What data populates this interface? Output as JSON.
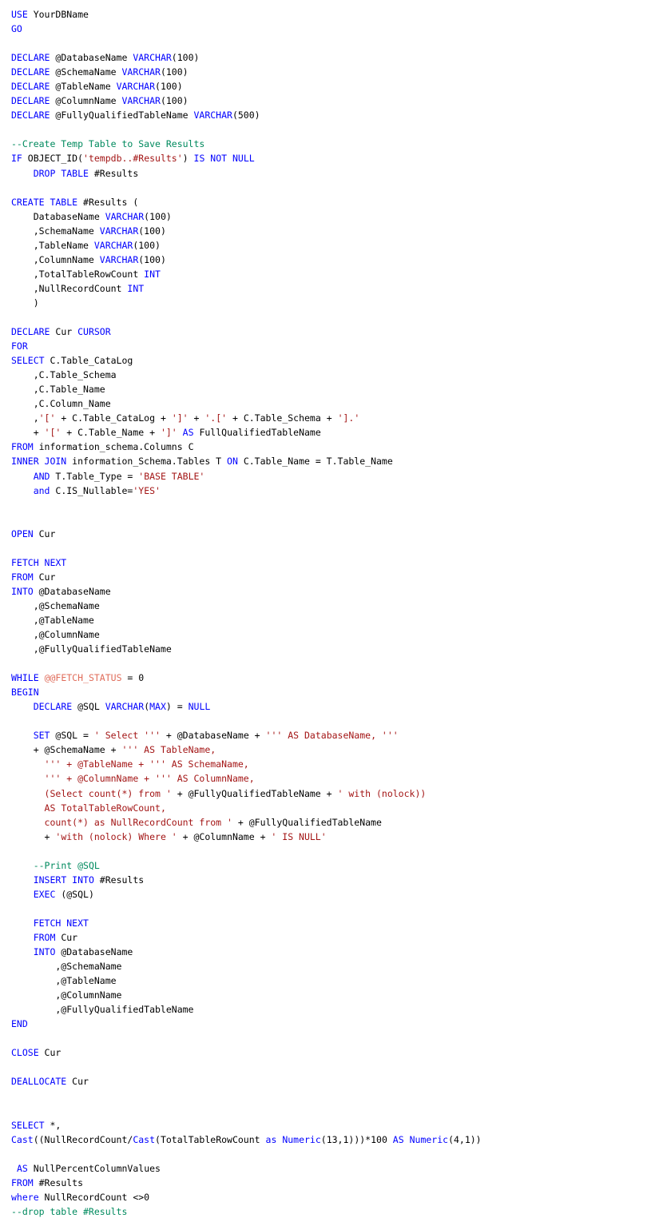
{
  "editor": {
    "language": "SQL",
    "title": "Null Column Values Report Script",
    "colors": {
      "background": "#ffffff",
      "plain": "#000000",
      "keyword": "#0000ff",
      "string": "#a31515",
      "comment": "#008a5e",
      "global_variable": "#e06c5a"
    }
  },
  "code": {
    "lines": [
      [
        [
          "kw",
          "USE"
        ],
        [
          "plain",
          " YourDBName"
        ]
      ],
      [
        [
          "kw",
          "GO"
        ]
      ],
      [],
      [
        [
          "kw",
          "DECLARE"
        ],
        [
          "plain",
          " @DatabaseName "
        ],
        [
          "kw",
          "VARCHAR"
        ],
        [
          "plain",
          "(100)"
        ]
      ],
      [
        [
          "kw",
          "DECLARE"
        ],
        [
          "plain",
          " @SchemaName "
        ],
        [
          "kw",
          "VARCHAR"
        ],
        [
          "plain",
          "(100)"
        ]
      ],
      [
        [
          "kw",
          "DECLARE"
        ],
        [
          "plain",
          " @TableName "
        ],
        [
          "kw",
          "VARCHAR"
        ],
        [
          "plain",
          "(100)"
        ]
      ],
      [
        [
          "kw",
          "DECLARE"
        ],
        [
          "plain",
          " @ColumnName "
        ],
        [
          "kw",
          "VARCHAR"
        ],
        [
          "plain",
          "(100)"
        ]
      ],
      [
        [
          "kw",
          "DECLARE"
        ],
        [
          "plain",
          " @FullyQualifiedTableName "
        ],
        [
          "kw",
          "VARCHAR"
        ],
        [
          "plain",
          "(500)"
        ]
      ],
      [],
      [
        [
          "cmt",
          "--Create Temp Table to Save Results"
        ]
      ],
      [
        [
          "kw",
          "IF"
        ],
        [
          "plain",
          " OBJECT_ID("
        ],
        [
          "str",
          "'tempdb..#Results'"
        ],
        [
          "plain",
          ") "
        ],
        [
          "kw",
          "IS NOT NULL"
        ]
      ],
      [
        [
          "plain",
          "    "
        ],
        [
          "kw",
          "DROP TABLE"
        ],
        [
          "plain",
          " #Results"
        ]
      ],
      [],
      [
        [
          "kw",
          "CREATE TABLE"
        ],
        [
          "plain",
          " #Results ("
        ]
      ],
      [
        [
          "plain",
          "    DatabaseName "
        ],
        [
          "kw",
          "VARCHAR"
        ],
        [
          "plain",
          "(100)"
        ]
      ],
      [
        [
          "plain",
          "    ,SchemaName "
        ],
        [
          "kw",
          "VARCHAR"
        ],
        [
          "plain",
          "(100)"
        ]
      ],
      [
        [
          "plain",
          "    ,TableName "
        ],
        [
          "kw",
          "VARCHAR"
        ],
        [
          "plain",
          "(100)"
        ]
      ],
      [
        [
          "plain",
          "    ,ColumnName "
        ],
        [
          "kw",
          "VARCHAR"
        ],
        [
          "plain",
          "(100)"
        ]
      ],
      [
        [
          "plain",
          "    ,TotalTableRowCount "
        ],
        [
          "kw",
          "INT"
        ]
      ],
      [
        [
          "plain",
          "    ,NullRecordCount "
        ],
        [
          "kw",
          "INT"
        ]
      ],
      [
        [
          "plain",
          "    )"
        ]
      ],
      [],
      [
        [
          "kw",
          "DECLARE"
        ],
        [
          "plain",
          " Cur "
        ],
        [
          "kw",
          "CURSOR"
        ]
      ],
      [
        [
          "kw",
          "FOR"
        ]
      ],
      [
        [
          "kw",
          "SELECT"
        ],
        [
          "plain",
          " C.Table_CataLog"
        ]
      ],
      [
        [
          "plain",
          "    ,C.Table_Schema"
        ]
      ],
      [
        [
          "plain",
          "    ,C.Table_Name"
        ]
      ],
      [
        [
          "plain",
          "    ,C.Column_Name"
        ]
      ],
      [
        [
          "plain",
          "    ,"
        ],
        [
          "str",
          "'['"
        ],
        [
          "plain",
          " + C.Table_CataLog + "
        ],
        [
          "str",
          "']'"
        ],
        [
          "plain",
          " + "
        ],
        [
          "str",
          "'.['"
        ],
        [
          "plain",
          " + C.Table_Schema + "
        ],
        [
          "str",
          "'].'"
        ]
      ],
      [
        [
          "plain",
          "    + "
        ],
        [
          "str",
          "'['"
        ],
        [
          "plain",
          " + C.Table_Name + "
        ],
        [
          "str",
          "']'"
        ],
        [
          "plain",
          " "
        ],
        [
          "kw",
          "AS"
        ],
        [
          "plain",
          " FullQualifiedTableName"
        ]
      ],
      [
        [
          "kw",
          "FROM"
        ],
        [
          "plain",
          " information_schema.Columns C"
        ]
      ],
      [
        [
          "kw",
          "INNER JOIN"
        ],
        [
          "plain",
          " information_Schema.Tables T "
        ],
        [
          "kw",
          "ON"
        ],
        [
          "plain",
          " C.Table_Name = T.Table_Name"
        ]
      ],
      [
        [
          "plain",
          "    "
        ],
        [
          "kw",
          "AND"
        ],
        [
          "plain",
          " T.Table_Type = "
        ],
        [
          "str",
          "'BASE TABLE'"
        ]
      ],
      [
        [
          "plain",
          "    "
        ],
        [
          "kw",
          "and"
        ],
        [
          "plain",
          " C.IS_Nullable="
        ],
        [
          "str",
          "'YES'"
        ]
      ],
      [],
      [],
      [
        [
          "kw",
          "OPEN"
        ],
        [
          "plain",
          " Cur"
        ]
      ],
      [],
      [
        [
          "kw",
          "FETCH NEXT"
        ]
      ],
      [
        [
          "kw",
          "FROM"
        ],
        [
          "plain",
          " Cur"
        ]
      ],
      [
        [
          "kw",
          "INTO"
        ],
        [
          "plain",
          " @DatabaseName"
        ]
      ],
      [
        [
          "plain",
          "    ,@SchemaName"
        ]
      ],
      [
        [
          "plain",
          "    ,@TableName"
        ]
      ],
      [
        [
          "plain",
          "    ,@ColumnName"
        ]
      ],
      [
        [
          "plain",
          "    ,@FullyQualifiedTableName"
        ]
      ],
      [],
      [
        [
          "kw",
          "WHILE"
        ],
        [
          "plain",
          " "
        ],
        [
          "gvar",
          "@@FETCH_STATUS"
        ],
        [
          "plain",
          " = 0"
        ]
      ],
      [
        [
          "kw",
          "BEGIN"
        ]
      ],
      [
        [
          "plain",
          "    "
        ],
        [
          "kw",
          "DECLARE"
        ],
        [
          "plain",
          " @SQL "
        ],
        [
          "kw",
          "VARCHAR"
        ],
        [
          "plain",
          "("
        ],
        [
          "kw",
          "MAX"
        ],
        [
          "plain",
          ") = "
        ],
        [
          "kw",
          "NULL"
        ]
      ],
      [],
      [
        [
          "plain",
          "    "
        ],
        [
          "kw",
          "SET"
        ],
        [
          "plain",
          " @SQL = "
        ],
        [
          "str",
          "' Select '''"
        ],
        [
          "plain",
          " + @DatabaseName + "
        ],
        [
          "str",
          "''' AS DatabaseName, '''"
        ]
      ],
      [
        [
          "plain",
          "    + @SchemaName + "
        ],
        [
          "str",
          "''' AS TableName,"
        ]
      ],
      [
        [
          "plain",
          "      "
        ],
        [
          "str",
          "''' + @TableName + ''' AS SchemaName,"
        ]
      ],
      [
        [
          "plain",
          "      "
        ],
        [
          "str",
          "''' + @ColumnName + ''' AS ColumnName,"
        ]
      ],
      [
        [
          "plain",
          "      "
        ],
        [
          "str",
          "(Select count(*) from '"
        ],
        [
          "plain",
          " + @FullyQualifiedTableName + "
        ],
        [
          "str",
          "' with (nolock))"
        ]
      ],
      [
        [
          "plain",
          "      "
        ],
        [
          "str",
          "AS TotalTableRowCount,"
        ]
      ],
      [
        [
          "plain",
          "      "
        ],
        [
          "str",
          "count(*) as NullRecordCount from '"
        ],
        [
          "plain",
          " + @FullyQualifiedTableName"
        ]
      ],
      [
        [
          "plain",
          "      + "
        ],
        [
          "str",
          "'with (nolock) Where '"
        ],
        [
          "plain",
          " + @ColumnName + "
        ],
        [
          "str",
          "' IS NULL'"
        ]
      ],
      [],
      [
        [
          "plain",
          "    "
        ],
        [
          "cmt",
          "--Print @SQL"
        ]
      ],
      [
        [
          "plain",
          "    "
        ],
        [
          "kw",
          "INSERT INTO"
        ],
        [
          "plain",
          " #Results"
        ]
      ],
      [
        [
          "plain",
          "    "
        ],
        [
          "kw",
          "EXEC"
        ],
        [
          "plain",
          " (@SQL)"
        ]
      ],
      [],
      [
        [
          "plain",
          "    "
        ],
        [
          "kw",
          "FETCH NEXT"
        ]
      ],
      [
        [
          "plain",
          "    "
        ],
        [
          "kw",
          "FROM"
        ],
        [
          "plain",
          " Cur"
        ]
      ],
      [
        [
          "plain",
          "    "
        ],
        [
          "kw",
          "INTO"
        ],
        [
          "plain",
          " @DatabaseName"
        ]
      ],
      [
        [
          "plain",
          "        ,@SchemaName"
        ]
      ],
      [
        [
          "plain",
          "        ,@TableName"
        ]
      ],
      [
        [
          "plain",
          "        ,@ColumnName"
        ]
      ],
      [
        [
          "plain",
          "        ,@FullyQualifiedTableName"
        ]
      ],
      [
        [
          "kw",
          "END"
        ]
      ],
      [],
      [
        [
          "kw",
          "CLOSE"
        ],
        [
          "plain",
          " Cur"
        ]
      ],
      [],
      [
        [
          "kw",
          "DEALLOCATE"
        ],
        [
          "plain",
          " Cur"
        ]
      ],
      [],
      [],
      [
        [
          "kw",
          "SELECT"
        ],
        [
          "plain",
          " *,"
        ]
      ],
      [
        [
          "kw",
          "Cast"
        ],
        [
          "plain",
          "((NullRecordCount/"
        ],
        [
          "kw",
          "Cast"
        ],
        [
          "plain",
          "(TotalTableRowCount "
        ],
        [
          "kw",
          "as"
        ],
        [
          "plain",
          " "
        ],
        [
          "kw",
          "Numeric"
        ],
        [
          "plain",
          "(13,1)))*100 "
        ],
        [
          "kw",
          "AS"
        ],
        [
          "plain",
          " "
        ],
        [
          "kw",
          "Numeric"
        ],
        [
          "plain",
          "(4,1))"
        ]
      ],
      [],
      [
        [
          "plain",
          " "
        ],
        [
          "kw",
          "AS"
        ],
        [
          "plain",
          " NullPercentColumnValues"
        ]
      ],
      [
        [
          "kw",
          "FROM"
        ],
        [
          "plain",
          " #Results"
        ]
      ],
      [
        [
          "kw",
          "where"
        ],
        [
          "plain",
          " NullRecordCount <>0"
        ]
      ],
      [
        [
          "cmt",
          "--drop table #Results"
        ]
      ]
    ]
  }
}
